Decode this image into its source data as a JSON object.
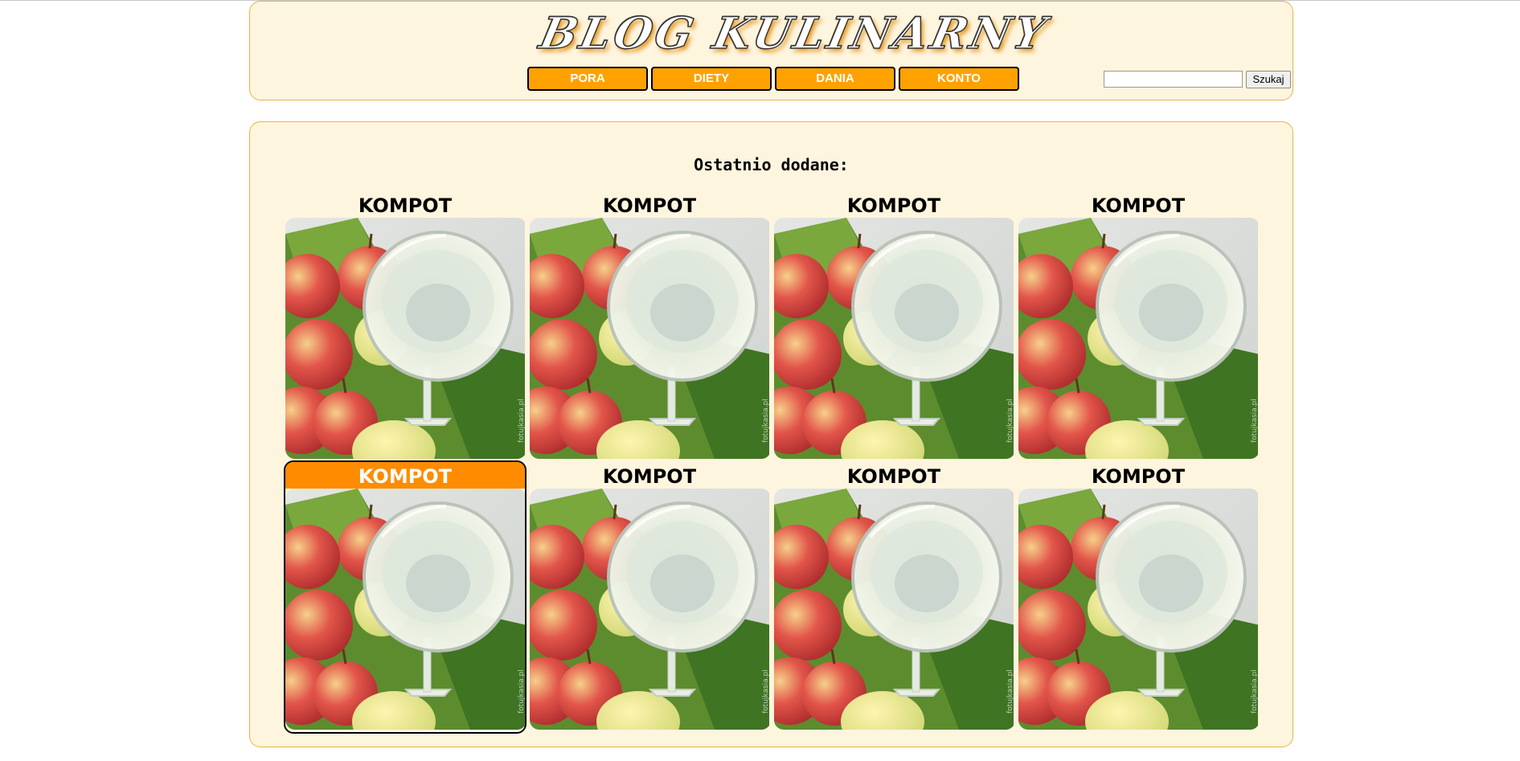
{
  "header": {
    "logo_text": "BLOG KULINARNY",
    "nav": [
      "PORA",
      "DIETY",
      "DANIA",
      "KONTO"
    ],
    "search": {
      "value": "",
      "button_label": "Szukaj"
    }
  },
  "main": {
    "section_title": "Ostatnio dodane:",
    "cards": [
      {
        "title": "KOMPOT",
        "active": false
      },
      {
        "title": "KOMPOT",
        "active": false
      },
      {
        "title": "KOMPOT",
        "active": false
      },
      {
        "title": "KOMPOT",
        "active": false
      },
      {
        "title": "KOMPOT",
        "active": true
      },
      {
        "title": "KOMPOT",
        "active": false
      },
      {
        "title": "KOMPOT",
        "active": false
      },
      {
        "title": "KOMPOT",
        "active": false
      }
    ],
    "photo": {
      "icon": "kompot-photo-image",
      "watermark": "fotujkasia.pl"
    }
  },
  "colors": {
    "panel_bg": "#fef5df",
    "panel_border": "#e6b44a",
    "nav_button": "#ffa200",
    "active_card": "#ff8c00"
  }
}
